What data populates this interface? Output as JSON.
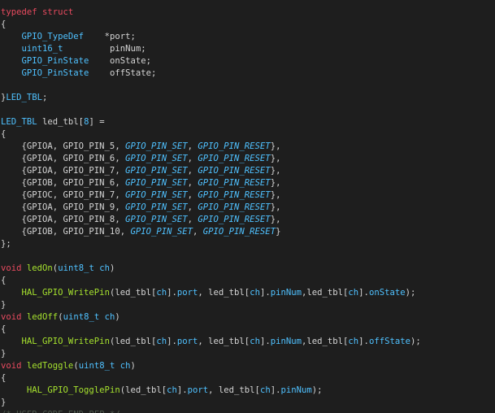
{
  "colors": {
    "background": "#1e1e1e",
    "keyword": "#e84a5f",
    "type": "#4fc1ff",
    "function": "#a6e22e",
    "plain": "#d4d4d4",
    "comment": "#4e5a4e"
  },
  "code": {
    "lines": [
      [
        {
          "t": "typedef struct",
          "c": "kw"
        }
      ],
      [
        {
          "t": "{",
          "c": "br"
        }
      ],
      [
        {
          "t": "    ",
          "c": "pl"
        },
        {
          "t": "GPIO_TypeDef",
          "c": "ty"
        },
        {
          "t": "    *port;",
          "c": "pl"
        }
      ],
      [
        {
          "t": "    ",
          "c": "pl"
        },
        {
          "t": "uint16_t",
          "c": "ty"
        },
        {
          "t": "         pinNum;",
          "c": "pl"
        }
      ],
      [
        {
          "t": "    ",
          "c": "pl"
        },
        {
          "t": "GPIO_PinState",
          "c": "ty"
        },
        {
          "t": "    onState;",
          "c": "pl"
        }
      ],
      [
        {
          "t": "    ",
          "c": "pl"
        },
        {
          "t": "GPIO_PinState",
          "c": "ty"
        },
        {
          "t": "    offState;",
          "c": "pl"
        }
      ],
      [],
      [
        {
          "t": "}",
          "c": "br"
        },
        {
          "t": "LED_TBL",
          "c": "ty"
        },
        {
          "t": ";",
          "c": "pl"
        }
      ],
      [],
      [
        {
          "t": "LED_TBL",
          "c": "ty"
        },
        {
          "t": " led_tbl[",
          "c": "pl"
        },
        {
          "t": "8",
          "c": "mb"
        },
        {
          "t": "] =",
          "c": "pl"
        }
      ],
      [
        {
          "t": "{",
          "c": "br"
        }
      ],
      [
        {
          "t": "    {GPIOA, GPIO_PIN_5, ",
          "c": "pl"
        },
        {
          "t": "GPIO_PIN_SET",
          "c": "en"
        },
        {
          "t": ", ",
          "c": "pl"
        },
        {
          "t": "GPIO_PIN_RESET",
          "c": "en"
        },
        {
          "t": "},",
          "c": "pl"
        }
      ],
      [
        {
          "t": "    {GPIOA, GPIO_PIN_6, ",
          "c": "pl"
        },
        {
          "t": "GPIO_PIN_SET",
          "c": "en"
        },
        {
          "t": ", ",
          "c": "pl"
        },
        {
          "t": "GPIO_PIN_RESET",
          "c": "en"
        },
        {
          "t": "},",
          "c": "pl"
        }
      ],
      [
        {
          "t": "    {GPIOA, GPIO_PIN_7, ",
          "c": "pl"
        },
        {
          "t": "GPIO_PIN_SET",
          "c": "en"
        },
        {
          "t": ", ",
          "c": "pl"
        },
        {
          "t": "GPIO_PIN_RESET",
          "c": "en"
        },
        {
          "t": "},",
          "c": "pl"
        }
      ],
      [
        {
          "t": "    {GPIOB, GPIO_PIN_6, ",
          "c": "pl"
        },
        {
          "t": "GPIO_PIN_SET",
          "c": "en"
        },
        {
          "t": ", ",
          "c": "pl"
        },
        {
          "t": "GPIO_PIN_RESET",
          "c": "en"
        },
        {
          "t": "},",
          "c": "pl"
        }
      ],
      [
        {
          "t": "    {GPIOC, GPIO_PIN_7, ",
          "c": "pl"
        },
        {
          "t": "GPIO_PIN_SET",
          "c": "en"
        },
        {
          "t": ", ",
          "c": "pl"
        },
        {
          "t": "GPIO_PIN_RESET",
          "c": "en"
        },
        {
          "t": "},",
          "c": "pl"
        }
      ],
      [
        {
          "t": "    {GPIOA, GPIO_PIN_9, ",
          "c": "pl"
        },
        {
          "t": "GPIO_PIN_SET",
          "c": "en"
        },
        {
          "t": ", ",
          "c": "pl"
        },
        {
          "t": "GPIO_PIN_RESET",
          "c": "en"
        },
        {
          "t": "},",
          "c": "pl"
        }
      ],
      [
        {
          "t": "    {GPIOA, GPIO_PIN_8, ",
          "c": "pl"
        },
        {
          "t": "GPIO_PIN_SET",
          "c": "en"
        },
        {
          "t": ", ",
          "c": "pl"
        },
        {
          "t": "GPIO_PIN_RESET",
          "c": "en"
        },
        {
          "t": "},",
          "c": "pl"
        }
      ],
      [
        {
          "t": "    {GPIOB, GPIO_PIN_10, ",
          "c": "pl"
        },
        {
          "t": "GPIO_PIN_SET",
          "c": "en"
        },
        {
          "t": ", ",
          "c": "pl"
        },
        {
          "t": "GPIO_PIN_RESET",
          "c": "en"
        },
        {
          "t": "}",
          "c": "pl"
        }
      ],
      [
        {
          "t": "};",
          "c": "br"
        }
      ],
      [],
      [
        {
          "t": "void",
          "c": "kw"
        },
        {
          "t": " ",
          "c": "pl"
        },
        {
          "t": "ledOn",
          "c": "fn"
        },
        {
          "t": "(",
          "c": "pl"
        },
        {
          "t": "uint8_t",
          "c": "ty"
        },
        {
          "t": " ",
          "c": "pl"
        },
        {
          "t": "ch",
          "c": "mb"
        },
        {
          "t": ")",
          "c": "pl"
        }
      ],
      [
        {
          "t": "{",
          "c": "br"
        }
      ],
      [
        {
          "t": "    ",
          "c": "pl"
        },
        {
          "t": "HAL_GPIO_WritePin",
          "c": "fn"
        },
        {
          "t": "(led_tbl[",
          "c": "pl"
        },
        {
          "t": "ch",
          "c": "mb"
        },
        {
          "t": "].",
          "c": "pl"
        },
        {
          "t": "port",
          "c": "mb"
        },
        {
          "t": ", led_tbl[",
          "c": "pl"
        },
        {
          "t": "ch",
          "c": "mb"
        },
        {
          "t": "].",
          "c": "pl"
        },
        {
          "t": "pinNum",
          "c": "mb"
        },
        {
          "t": ",led_tbl[",
          "c": "pl"
        },
        {
          "t": "ch",
          "c": "mb"
        },
        {
          "t": "].",
          "c": "pl"
        },
        {
          "t": "onState",
          "c": "mb"
        },
        {
          "t": ");",
          "c": "pl"
        }
      ],
      [
        {
          "t": "}",
          "c": "br"
        }
      ],
      [
        {
          "t": "void",
          "c": "kw"
        },
        {
          "t": " ",
          "c": "pl"
        },
        {
          "t": "ledOff",
          "c": "fn"
        },
        {
          "t": "(",
          "c": "pl"
        },
        {
          "t": "uint8_t",
          "c": "ty"
        },
        {
          "t": " ",
          "c": "pl"
        },
        {
          "t": "ch",
          "c": "mb"
        },
        {
          "t": ")",
          "c": "pl"
        }
      ],
      [
        {
          "t": "{",
          "c": "br"
        }
      ],
      [
        {
          "t": "    ",
          "c": "pl"
        },
        {
          "t": "HAL_GPIO_WritePin",
          "c": "fn"
        },
        {
          "t": "(led_tbl[",
          "c": "pl"
        },
        {
          "t": "ch",
          "c": "mb"
        },
        {
          "t": "].",
          "c": "pl"
        },
        {
          "t": "port",
          "c": "mb"
        },
        {
          "t": ", led_tbl[",
          "c": "pl"
        },
        {
          "t": "ch",
          "c": "mb"
        },
        {
          "t": "].",
          "c": "pl"
        },
        {
          "t": "pinNum",
          "c": "mb"
        },
        {
          "t": ",led_tbl[",
          "c": "pl"
        },
        {
          "t": "ch",
          "c": "mb"
        },
        {
          "t": "].",
          "c": "pl"
        },
        {
          "t": "offState",
          "c": "mb"
        },
        {
          "t": ");",
          "c": "pl"
        }
      ],
      [
        {
          "t": "}",
          "c": "br"
        }
      ],
      [
        {
          "t": "void",
          "c": "kw"
        },
        {
          "t": " ",
          "c": "pl"
        },
        {
          "t": "ledToggle",
          "c": "fn"
        },
        {
          "t": "(",
          "c": "pl"
        },
        {
          "t": "uint8_t",
          "c": "ty"
        },
        {
          "t": " ",
          "c": "pl"
        },
        {
          "t": "ch",
          "c": "mb"
        },
        {
          "t": ")",
          "c": "pl"
        }
      ],
      [
        {
          "t": "{",
          "c": "br"
        }
      ],
      [
        {
          "t": "     ",
          "c": "pl"
        },
        {
          "t": "HAL_GPIO_TogglePin",
          "c": "fn"
        },
        {
          "t": "(led_tbl[",
          "c": "pl"
        },
        {
          "t": "ch",
          "c": "mb"
        },
        {
          "t": "].",
          "c": "pl"
        },
        {
          "t": "port",
          "c": "mb"
        },
        {
          "t": ", led_tbl[",
          "c": "pl"
        },
        {
          "t": "ch",
          "c": "mb"
        },
        {
          "t": "].",
          "c": "pl"
        },
        {
          "t": "pinNum",
          "c": "mb"
        },
        {
          "t": ");",
          "c": "pl"
        }
      ],
      [
        {
          "t": "}",
          "c": "br"
        }
      ],
      [
        {
          "t": "/* USER CODE END PFP */",
          "c": "cm"
        }
      ]
    ]
  }
}
